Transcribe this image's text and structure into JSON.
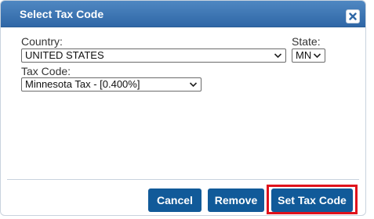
{
  "dialog": {
    "title": "Select Tax Code",
    "close_icon": "close-icon"
  },
  "form": {
    "country_label": "Country:",
    "country_value": "UNITED STATES",
    "state_label": "State:",
    "state_value": "MN",
    "tax_code_label": "Tax Code:",
    "tax_code_value": "Minnesota Tax - [0.400%]"
  },
  "buttons": {
    "cancel": "Cancel",
    "remove": "Remove",
    "set_tax_code": "Set Tax Code"
  },
  "colors": {
    "titlebar": "#3a74b2",
    "button": "#115a99",
    "highlight": "#e0121b"
  }
}
